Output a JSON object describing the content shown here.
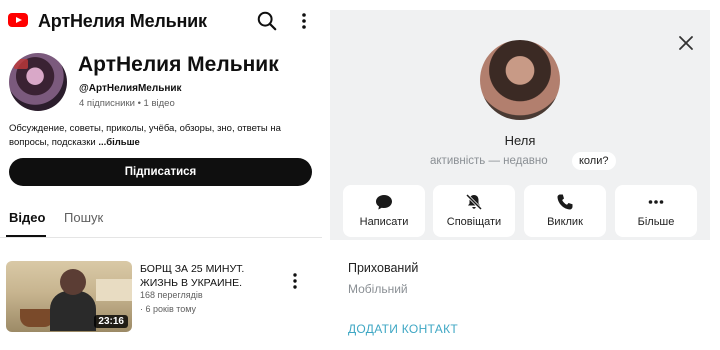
{
  "youtube": {
    "app_title": "АртНелия Мельник",
    "channel": {
      "name": "АртНелия Мельник",
      "handle": "@АртНелияМельник",
      "stats": "4 підписники • 1 відео",
      "description": "Обсуждение, советы, приколы, учёба, обзоры, зно, ответы на вопросы, подсказки",
      "more_label": "...більше",
      "subscribe_label": "Підписатися"
    },
    "tabs": [
      {
        "label": "Відео",
        "active": true
      },
      {
        "label": "Пошук",
        "active": false
      }
    ],
    "videos": [
      {
        "title": "БОРЩ ЗА 25 МИНУТ. ЖИЗНЬ В УКРАИНЕ.",
        "duration": "23:16",
        "views": "168 переглядів",
        "age": "· 6 років тому"
      }
    ],
    "icons": {
      "logo": "youtube-logo-icon",
      "search": "search-icon",
      "menu": "more-vertical-icon"
    },
    "accent_color": "#ff0000"
  },
  "contact": {
    "name": "Неля",
    "status": "активність — недавно",
    "when_label": "коли?",
    "actions": [
      {
        "label": "Написати",
        "icon": "message-icon"
      },
      {
        "label": "Сповіщати",
        "icon": "bell-off-icon"
      },
      {
        "label": "Виклик",
        "icon": "phone-icon"
      },
      {
        "label": "Більше",
        "icon": "more-horizontal-icon"
      }
    ],
    "info_label": "Прихований",
    "info_sub": "Мобільний",
    "add_contact_label": "ДОДАТИ КОНТАКТ",
    "link_color": "#3fa7c4"
  }
}
